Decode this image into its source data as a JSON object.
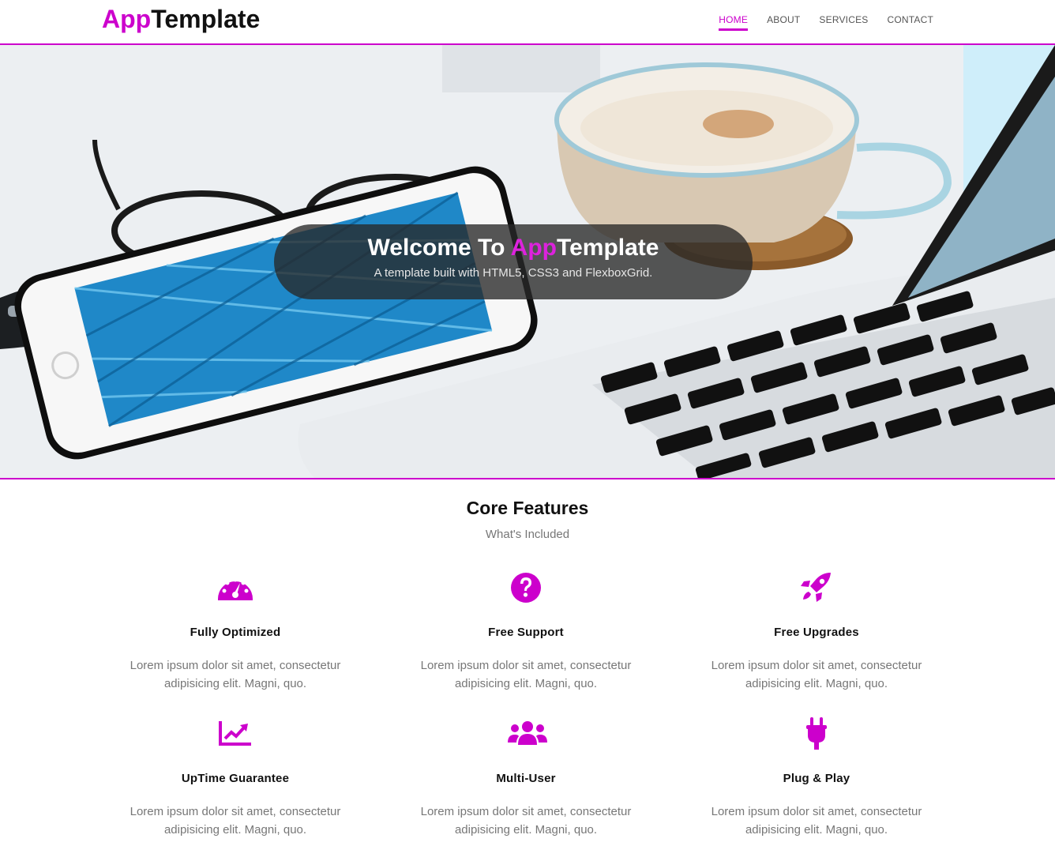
{
  "header": {
    "logo_accent": "App",
    "logo_rest": "Template",
    "nav": [
      "HOME",
      "ABOUT",
      "SERVICES",
      "CONTACT"
    ],
    "active_nav": "HOME"
  },
  "hero": {
    "title_prefix": "Welcome To ",
    "title_accent": "App",
    "title_rest": "Template",
    "subtitle": "A template built with HTML5, CSS3 and FlexboxGrid."
  },
  "features": {
    "title": "Core Features",
    "subtitle": "What's Included",
    "items": [
      {
        "icon": "tachometer-icon",
        "title": "Fully Optimized",
        "text": "Lorem ipsum dolor sit amet, consectetur adipisicing elit. Magni, quo."
      },
      {
        "icon": "question-circle-icon",
        "title": "Free Support",
        "text": "Lorem ipsum dolor sit amet, consectetur adipisicing elit. Magni, quo."
      },
      {
        "icon": "rocket-icon",
        "title": "Free Upgrades",
        "text": "Lorem ipsum dolor sit amet, consectetur adipisicing elit. Magni, quo."
      },
      {
        "icon": "chart-line-icon",
        "title": "UpTime Guarantee",
        "text": "Lorem ipsum dolor sit amet, consectetur adipisicing elit. Magni, quo."
      },
      {
        "icon": "users-icon",
        "title": "Multi-User",
        "text": "Lorem ipsum dolor sit amet, consectetur adipisicing elit. Magni, quo."
      },
      {
        "icon": "plug-icon",
        "title": "Plug & Play",
        "text": "Lorem ipsum dolor sit amet, consectetur adipisicing elit. Magni, quo."
      }
    ]
  },
  "colors": {
    "accent": "#cc00cc",
    "text_dark": "#111111",
    "text_muted": "#777777"
  }
}
